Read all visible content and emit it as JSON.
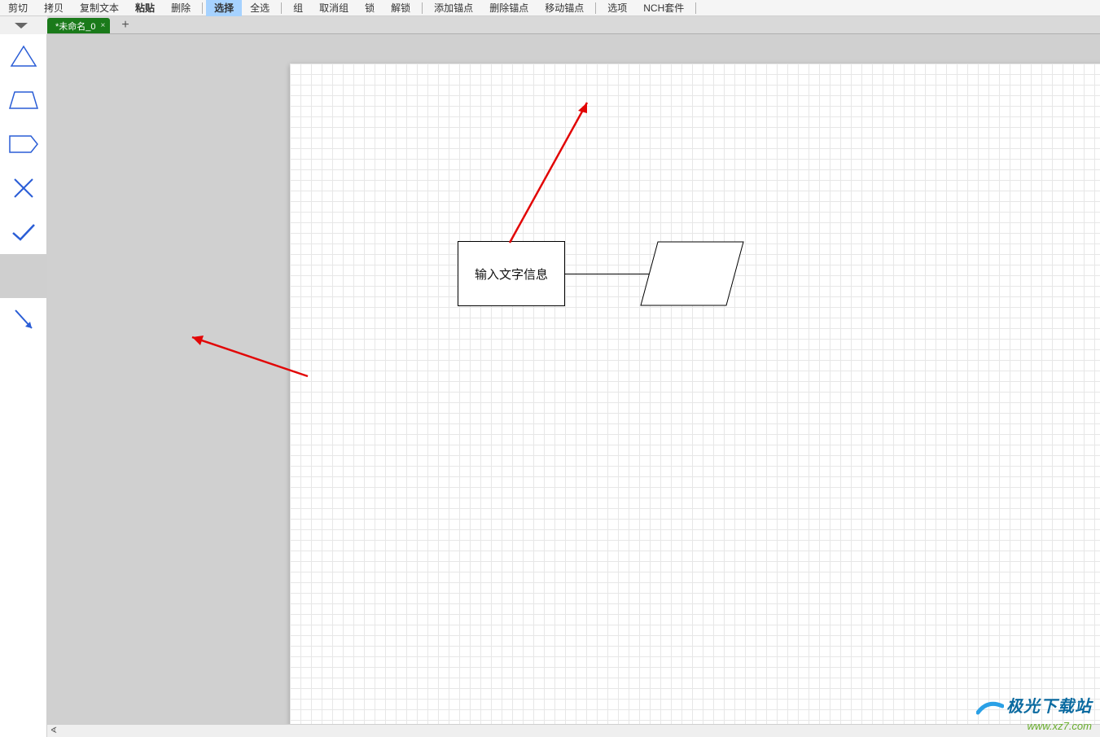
{
  "toolbar": {
    "items": [
      {
        "label": "剪切",
        "bold": false
      },
      {
        "label": "拷贝",
        "bold": false
      },
      {
        "label": "复制文本",
        "bold": false
      },
      {
        "label": "粘贴",
        "bold": true
      },
      {
        "label": "删除",
        "bold": false
      },
      {
        "sep": true
      },
      {
        "label": "选择",
        "bold": true,
        "selected": true
      },
      {
        "label": "全选",
        "bold": false
      },
      {
        "sep": true
      },
      {
        "label": "组",
        "bold": false
      },
      {
        "label": "取消组",
        "bold": false
      },
      {
        "label": "锁",
        "bold": false
      },
      {
        "label": "解锁",
        "bold": false
      },
      {
        "sep": true
      },
      {
        "label": "添加锚点",
        "bold": false
      },
      {
        "label": "删除锚点",
        "bold": false
      },
      {
        "label": "移动锚点",
        "bold": false
      },
      {
        "sep": true
      },
      {
        "label": "选项",
        "bold": false
      },
      {
        "label": "NCH套件",
        "bold": false
      },
      {
        "sep": true
      }
    ]
  },
  "tab": {
    "title": "*未命名_0",
    "close": "×",
    "plus": "+"
  },
  "sidebar": {
    "shapes": [
      {
        "name": "triangle-icon"
      },
      {
        "name": "trapezoid-icon"
      },
      {
        "name": "hexagon-icon"
      },
      {
        "name": "cross-icon"
      },
      {
        "name": "check-icon"
      },
      {
        "name": "blank-slot",
        "selected": true
      },
      {
        "name": "arrow-down-right-icon"
      }
    ]
  },
  "canvas": {
    "rect_text": "输入文字信息"
  },
  "watermark": {
    "brand": "极光下载站",
    "url": "www.xz7.com"
  }
}
